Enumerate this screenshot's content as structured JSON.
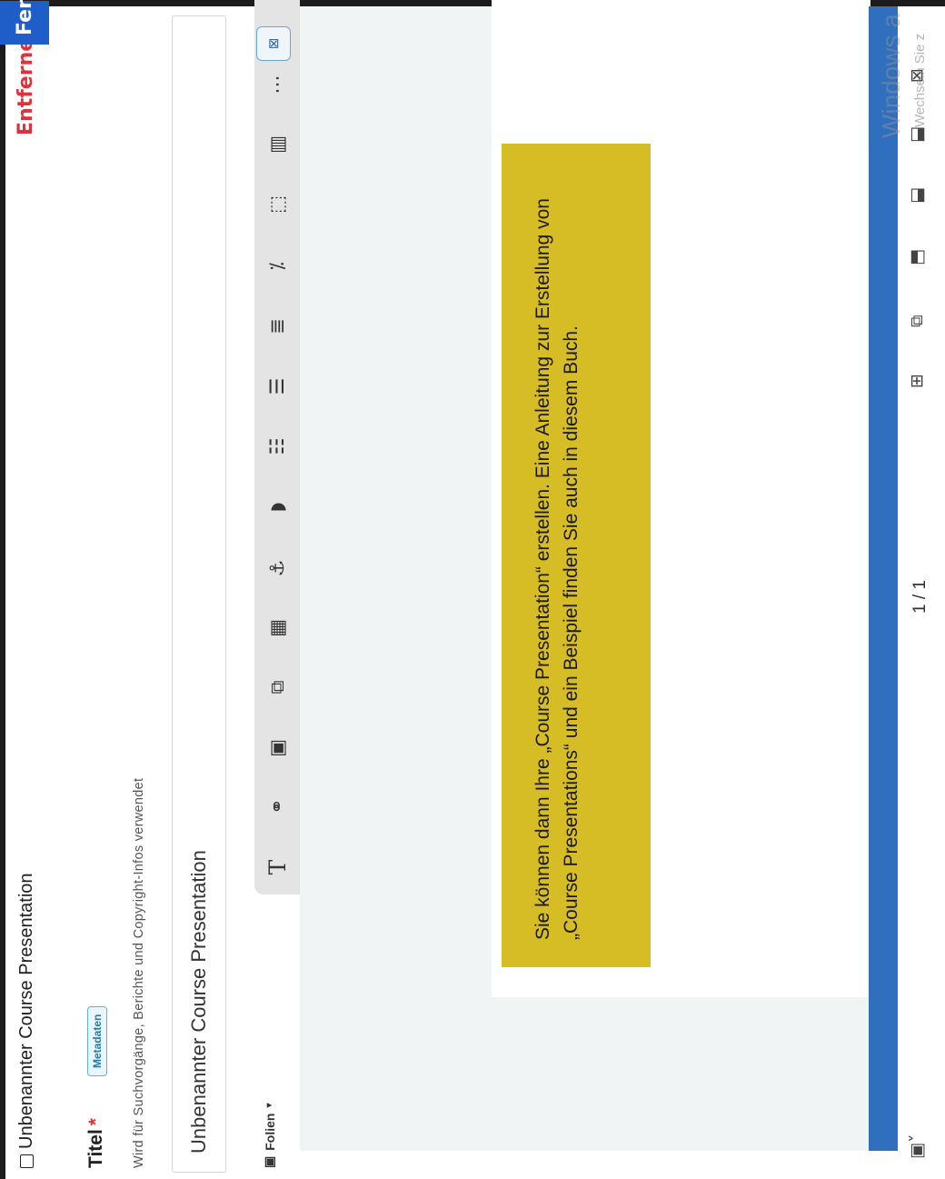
{
  "header": {
    "title": "Unbenannter Course Presentation",
    "remove_label": "Entfernen",
    "primary_label": "Fer"
  },
  "form": {
    "title_label": "Titel",
    "required_mark": "*",
    "metadata_badge": "Metadaten",
    "help_text": "Wird für Suchvorgänge, Berichte und Copyright-Infos verwendet",
    "title_value": "Unbenannter Course Presentation"
  },
  "editor": {
    "slides_tab": "Folien",
    "page_indicator": "1 / 1",
    "toolbar_icons": [
      "text-icon",
      "link-icon",
      "image-icon",
      "shape-icon",
      "table-icon",
      "anchor-icon",
      "audio-icon",
      "sliders-icon",
      "multiple-choice-icon",
      "checklist-icon",
      "toggle-icon",
      "drag-icon",
      "list-icon",
      "more-icon"
    ]
  },
  "note": {
    "text": "Sie können dann Ihre „Course Presentation“ erstellen. Eine Anleitung zur Erstellung von „Course Presentations“ und ein Beispiel finden Sie auch in diesem Buch."
  },
  "watermark": {
    "line1": "Windows a",
    "line2": "Wechseln Sie z"
  },
  "colors": {
    "accent": "#2f6fbd",
    "remove": "#e0323c",
    "note_bg": "#d6bd26"
  }
}
